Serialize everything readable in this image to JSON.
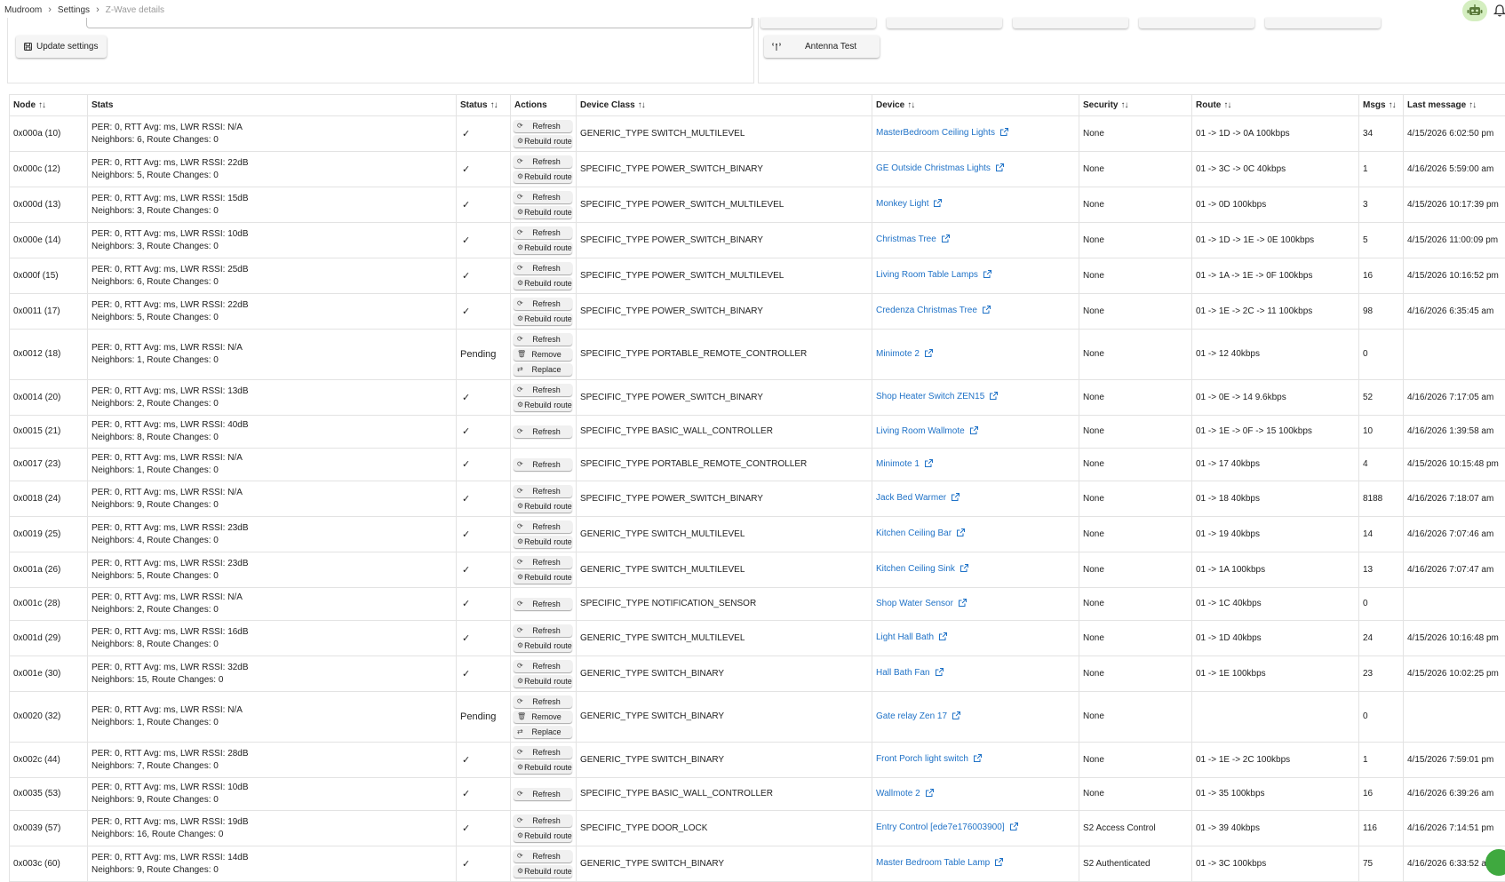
{
  "breadcrumb": [
    "Mudroom",
    "Settings",
    "Z-Wave details"
  ],
  "header_icons": [
    "robot-icon",
    "bell-icon"
  ],
  "left_panel": {
    "update_label": "Update settings"
  },
  "right_panel": {
    "antenna_label": "Antenna Test"
  },
  "columns": [
    "Node",
    "Stats",
    "Status",
    "Actions",
    "Device Class",
    "Device",
    "Security",
    "Route",
    "Msgs",
    "Last message"
  ],
  "sortable_columns": [
    "Node",
    "Status",
    "Device Class",
    "Device",
    "Security",
    "Route",
    "Msgs",
    "Last message"
  ],
  "rows": [
    {
      "node": "0x000a (10)",
      "stats1": "PER: 0, RTT Avg: ms, LWR RSSI: N/A",
      "stats2": "Neighbors: 6, Route Changes: 0",
      "status": "✓",
      "actions": [
        "Refresh",
        "Rebuild route"
      ],
      "device_class": "GENERIC_TYPE SWITCH_MULTILEVEL",
      "device": "MasterBedroom Ceiling Lights",
      "security": "None",
      "route": "01 -> 1D -> 0A 100kbps",
      "msgs": "34",
      "last": "4/15/2026 6:02:50 pm"
    },
    {
      "node": "0x000c (12)",
      "stats1": "PER: 0, RTT Avg: ms, LWR RSSI: 22dB",
      "stats2": "Neighbors: 5, Route Changes: 0",
      "status": "✓",
      "actions": [
        "Refresh",
        "Rebuild route"
      ],
      "device_class": "SPECIFIC_TYPE POWER_SWITCH_BINARY",
      "device": "GE Outside Christmas Lights",
      "security": "None",
      "route": "01 -> 3C -> 0C 40kbps",
      "msgs": "1",
      "last": "4/16/2026 5:59:00 am"
    },
    {
      "node": "0x000d (13)",
      "stats1": "PER: 0, RTT Avg: ms, LWR RSSI: 15dB",
      "stats2": "Neighbors: 3, Route Changes: 0",
      "status": "✓",
      "actions": [
        "Refresh",
        "Rebuild route"
      ],
      "device_class": "SPECIFIC_TYPE POWER_SWITCH_MULTILEVEL",
      "device": "Monkey Light",
      "security": "None",
      "route": "01 -> 0D 100kbps",
      "msgs": "3",
      "last": "4/15/2026 10:17:39 pm"
    },
    {
      "node": "0x000e (14)",
      "stats1": "PER: 0, RTT Avg: ms, LWR RSSI: 10dB",
      "stats2": "Neighbors: 3, Route Changes: 0",
      "status": "✓",
      "actions": [
        "Refresh",
        "Rebuild route"
      ],
      "device_class": "SPECIFIC_TYPE POWER_SWITCH_BINARY",
      "device": "Christmas Tree",
      "security": "None",
      "route": "01 -> 1D -> 1E -> 0E 100kbps",
      "msgs": "5",
      "last": "4/15/2026 11:00:09 pm"
    },
    {
      "node": "0x000f (15)",
      "stats1": "PER: 0, RTT Avg: ms, LWR RSSI: 25dB",
      "stats2": "Neighbors: 6, Route Changes: 0",
      "status": "✓",
      "actions": [
        "Refresh",
        "Rebuild route"
      ],
      "device_class": "SPECIFIC_TYPE POWER_SWITCH_MULTILEVEL",
      "device": "Living Room Table Lamps",
      "security": "None",
      "route": "01 -> 1A -> 1E -> 0F 100kbps",
      "msgs": "16",
      "last": "4/15/2026 10:16:52 pm"
    },
    {
      "node": "0x0011 (17)",
      "stats1": "PER: 0, RTT Avg: ms, LWR RSSI: 22dB",
      "stats2": "Neighbors: 5, Route Changes: 0",
      "status": "✓",
      "actions": [
        "Refresh",
        "Rebuild route"
      ],
      "device_class": "SPECIFIC_TYPE POWER_SWITCH_BINARY",
      "device": "Credenza Christmas Tree",
      "security": "None",
      "route": "01 -> 1E -> 2C -> 11 100kbps",
      "msgs": "98",
      "last": "4/16/2026 6:35:45 am"
    },
    {
      "node": "0x0012 (18)",
      "stats1": "PER: 0, RTT Avg: ms, LWR RSSI: N/A",
      "stats2": "Neighbors: 1, Route Changes: 0",
      "status": "Pending",
      "actions": [
        "Refresh",
        "Remove",
        "Replace"
      ],
      "device_class": "SPECIFIC_TYPE PORTABLE_REMOTE_CONTROLLER",
      "device": "Minimote 2",
      "security": "None",
      "route": "01 -> 12 40kbps",
      "msgs": "0",
      "last": ""
    },
    {
      "node": "0x0014 (20)",
      "stats1": "PER: 0, RTT Avg: ms, LWR RSSI: 13dB",
      "stats2": "Neighbors: 2, Route Changes: 0",
      "status": "✓",
      "actions": [
        "Refresh",
        "Rebuild route"
      ],
      "device_class": "SPECIFIC_TYPE POWER_SWITCH_BINARY",
      "device": "Shop Heater Switch ZEN15",
      "security": "None",
      "route": "01 -> 0E -> 14 9.6kbps",
      "msgs": "52",
      "last": "4/16/2026 7:17:05 am"
    },
    {
      "node": "0x0015 (21)",
      "stats1": "PER: 0, RTT Avg: ms, LWR RSSI: 40dB",
      "stats2": "Neighbors: 8, Route Changes: 0",
      "status": "✓",
      "actions": [
        "Refresh"
      ],
      "device_class": "SPECIFIC_TYPE BASIC_WALL_CONTROLLER",
      "device": "Living Room Wallmote",
      "security": "None",
      "route": "01 -> 1E -> 0F -> 15 100kbps",
      "msgs": "10",
      "last": "4/16/2026 1:39:58 am"
    },
    {
      "node": "0x0017 (23)",
      "stats1": "PER: 0, RTT Avg: ms, LWR RSSI: N/A",
      "stats2": "Neighbors: 1, Route Changes: 0",
      "status": "✓",
      "actions": [
        "Refresh"
      ],
      "device_class": "SPECIFIC_TYPE PORTABLE_REMOTE_CONTROLLER",
      "device": "Minimote 1",
      "security": "None",
      "route": "01 -> 17 40kbps",
      "msgs": "4",
      "last": "4/15/2026 10:15:48 pm"
    },
    {
      "node": "0x0018 (24)",
      "stats1": "PER: 0, RTT Avg: ms, LWR RSSI: N/A",
      "stats2": "Neighbors: 9, Route Changes: 0",
      "status": "✓",
      "actions": [
        "Refresh",
        "Rebuild route"
      ],
      "device_class": "SPECIFIC_TYPE POWER_SWITCH_BINARY",
      "device": "Jack Bed Warmer",
      "security": "None",
      "route": "01 -> 18 40kbps",
      "msgs": "8188",
      "last": "4/16/2026 7:18:07 am"
    },
    {
      "node": "0x0019 (25)",
      "stats1": "PER: 0, RTT Avg: ms, LWR RSSI: 23dB",
      "stats2": "Neighbors: 4, Route Changes: 0",
      "status": "✓",
      "actions": [
        "Refresh",
        "Rebuild route"
      ],
      "device_class": "GENERIC_TYPE SWITCH_MULTILEVEL",
      "device": "Kitchen Ceiling Bar",
      "security": "None",
      "route": "01 -> 19 40kbps",
      "msgs": "14",
      "last": "4/16/2026 7:07:46 am"
    },
    {
      "node": "0x001a (26)",
      "stats1": "PER: 0, RTT Avg: ms, LWR RSSI: 23dB",
      "stats2": "Neighbors: 5, Route Changes: 0",
      "status": "✓",
      "actions": [
        "Refresh",
        "Rebuild route"
      ],
      "device_class": "GENERIC_TYPE SWITCH_MULTILEVEL",
      "device": "Kitchen Ceiling Sink",
      "security": "None",
      "route": "01 -> 1A 100kbps",
      "msgs": "13",
      "last": "4/16/2026 7:07:47 am"
    },
    {
      "node": "0x001c (28)",
      "stats1": "PER: 0, RTT Avg: ms, LWR RSSI: N/A",
      "stats2": "Neighbors: 2, Route Changes: 0",
      "status": "✓",
      "actions": [
        "Refresh"
      ],
      "device_class": "SPECIFIC_TYPE NOTIFICATION_SENSOR",
      "device": "Shop Water Sensor",
      "security": "None",
      "route": "01 -> 1C 40kbps",
      "msgs": "0",
      "last": ""
    },
    {
      "node": "0x001d (29)",
      "stats1": "PER: 0, RTT Avg: ms, LWR RSSI: 16dB",
      "stats2": "Neighbors: 8, Route Changes: 0",
      "status": "✓",
      "actions": [
        "Refresh",
        "Rebuild route"
      ],
      "device_class": "GENERIC_TYPE SWITCH_MULTILEVEL",
      "device": "Light Hall Bath",
      "security": "None",
      "route": "01 -> 1D 40kbps",
      "msgs": "24",
      "last": "4/15/2026 10:16:48 pm"
    },
    {
      "node": "0x001e (30)",
      "stats1": "PER: 0, RTT Avg: ms, LWR RSSI: 32dB",
      "stats2": "Neighbors: 15, Route Changes: 0",
      "status": "✓",
      "actions": [
        "Refresh",
        "Rebuild route"
      ],
      "device_class": "GENERIC_TYPE SWITCH_BINARY",
      "device": "Hall Bath Fan",
      "security": "None",
      "route": "01 -> 1E 100kbps",
      "msgs": "23",
      "last": "4/15/2026 10:02:25 pm"
    },
    {
      "node": "0x0020 (32)",
      "stats1": "PER: 0, RTT Avg: ms, LWR RSSI: N/A",
      "stats2": "Neighbors: 1, Route Changes: 0",
      "status": "Pending",
      "actions": [
        "Refresh",
        "Remove",
        "Replace"
      ],
      "device_class": "GENERIC_TYPE SWITCH_BINARY",
      "device": "Gate relay Zen 17",
      "security": "None",
      "route": "",
      "msgs": "0",
      "last": ""
    },
    {
      "node": "0x002c (44)",
      "stats1": "PER: 0, RTT Avg: ms, LWR RSSI: 28dB",
      "stats2": "Neighbors: 7, Route Changes: 0",
      "status": "✓",
      "actions": [
        "Refresh",
        "Rebuild route"
      ],
      "device_class": "GENERIC_TYPE SWITCH_BINARY",
      "device": "Front Porch light switch",
      "security": "None",
      "route": "01 -> 1E -> 2C 100kbps",
      "msgs": "1",
      "last": "4/15/2026 7:59:01 pm"
    },
    {
      "node": "0x0035 (53)",
      "stats1": "PER: 0, RTT Avg: ms, LWR RSSI: 10dB",
      "stats2": "Neighbors: 9, Route Changes: 0",
      "status": "✓",
      "actions": [
        "Refresh"
      ],
      "device_class": "SPECIFIC_TYPE BASIC_WALL_CONTROLLER",
      "device": "Wallmote 2",
      "security": "None",
      "route": "01 -> 35 100kbps",
      "msgs": "16",
      "last": "4/16/2026 6:39:26 am"
    },
    {
      "node": "0x0039 (57)",
      "stats1": "PER: 0, RTT Avg: ms, LWR RSSI: 19dB",
      "stats2": "Neighbors: 16, Route Changes: 0",
      "status": "✓",
      "actions": [
        "Refresh",
        "Rebuild route"
      ],
      "device_class": "SPECIFIC_TYPE DOOR_LOCK",
      "device": "Entry Control [ede7e176003900]",
      "security": "S2 Access Control",
      "route": "01 -> 39 40kbps",
      "msgs": "116",
      "last": "4/16/2026 7:14:51 pm"
    },
    {
      "node": "0x003c (60)",
      "stats1": "PER: 0, RTT Avg: ms, LWR RSSI: 14dB",
      "stats2": "Neighbors: 9, Route Changes: 0",
      "status": "✓",
      "actions": [
        "Refresh",
        "Rebuild route"
      ],
      "device_class": "GENERIC_TYPE SWITCH_BINARY",
      "device": "Master Bedroom Table Lamp",
      "security": "S2 Authenticated",
      "route": "01 -> 3C 100kbps",
      "msgs": "75",
      "last": "4/16/2026 6:33:52 am"
    }
  ]
}
